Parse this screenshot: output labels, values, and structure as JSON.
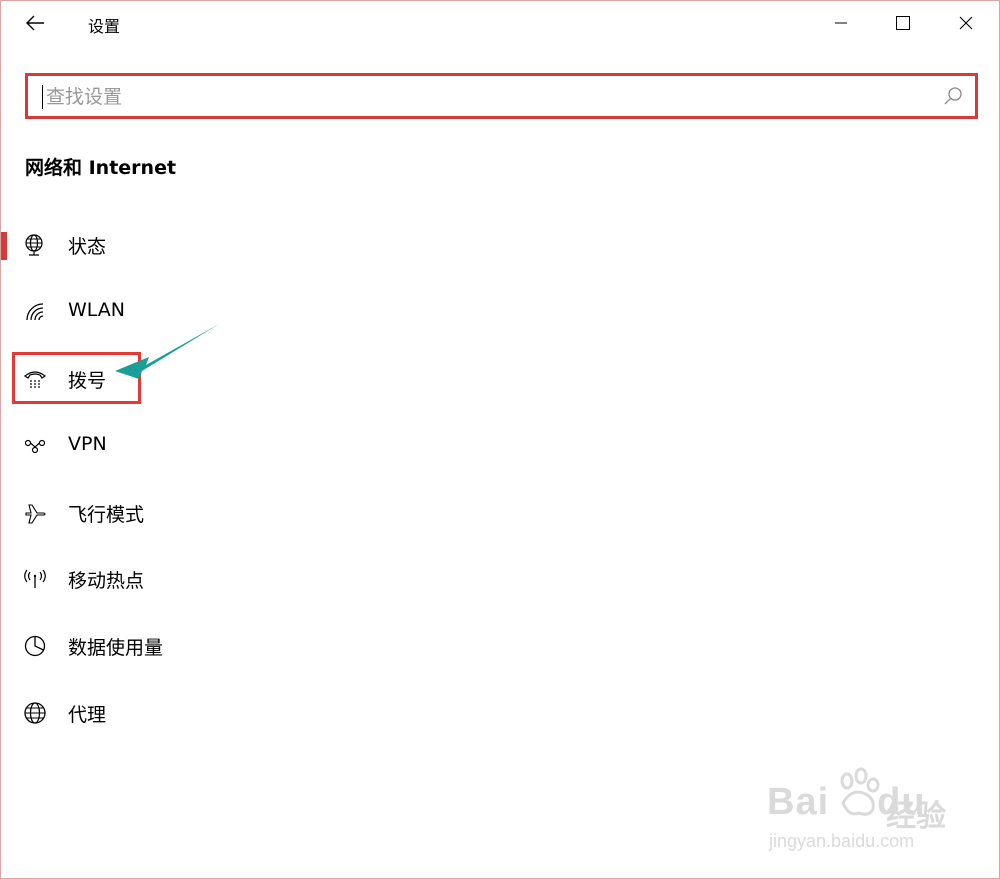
{
  "window": {
    "title": "设置",
    "controls": {
      "minimize": "minimize",
      "maximize": "maximize",
      "close": "close"
    }
  },
  "search": {
    "placeholder": "查找设置",
    "value": ""
  },
  "section": {
    "title": "网络和 Internet"
  },
  "nav": {
    "items": [
      {
        "label": "状态",
        "icon": "status-globe-icon",
        "active": true
      },
      {
        "label": "WLAN",
        "icon": "wifi-icon",
        "active": false
      },
      {
        "label": "拨号",
        "icon": "dialup-phone-icon",
        "active": false
      },
      {
        "label": "VPN",
        "icon": "vpn-icon",
        "active": false
      },
      {
        "label": "飞行模式",
        "icon": "airplane-icon",
        "active": false
      },
      {
        "label": "移动热点",
        "icon": "hotspot-icon",
        "active": false
      },
      {
        "label": "数据使用量",
        "icon": "data-usage-icon",
        "active": false
      },
      {
        "label": "代理",
        "icon": "globe-icon",
        "active": false
      }
    ]
  },
  "watermark": {
    "brand": "Bai",
    "brand_suffix": "du",
    "cn": "经验",
    "url": "jingyan.baidu.com"
  },
  "colors": {
    "accent": "#d63b3b",
    "arrow": "#1a9e96",
    "highlight": "#e53935"
  }
}
